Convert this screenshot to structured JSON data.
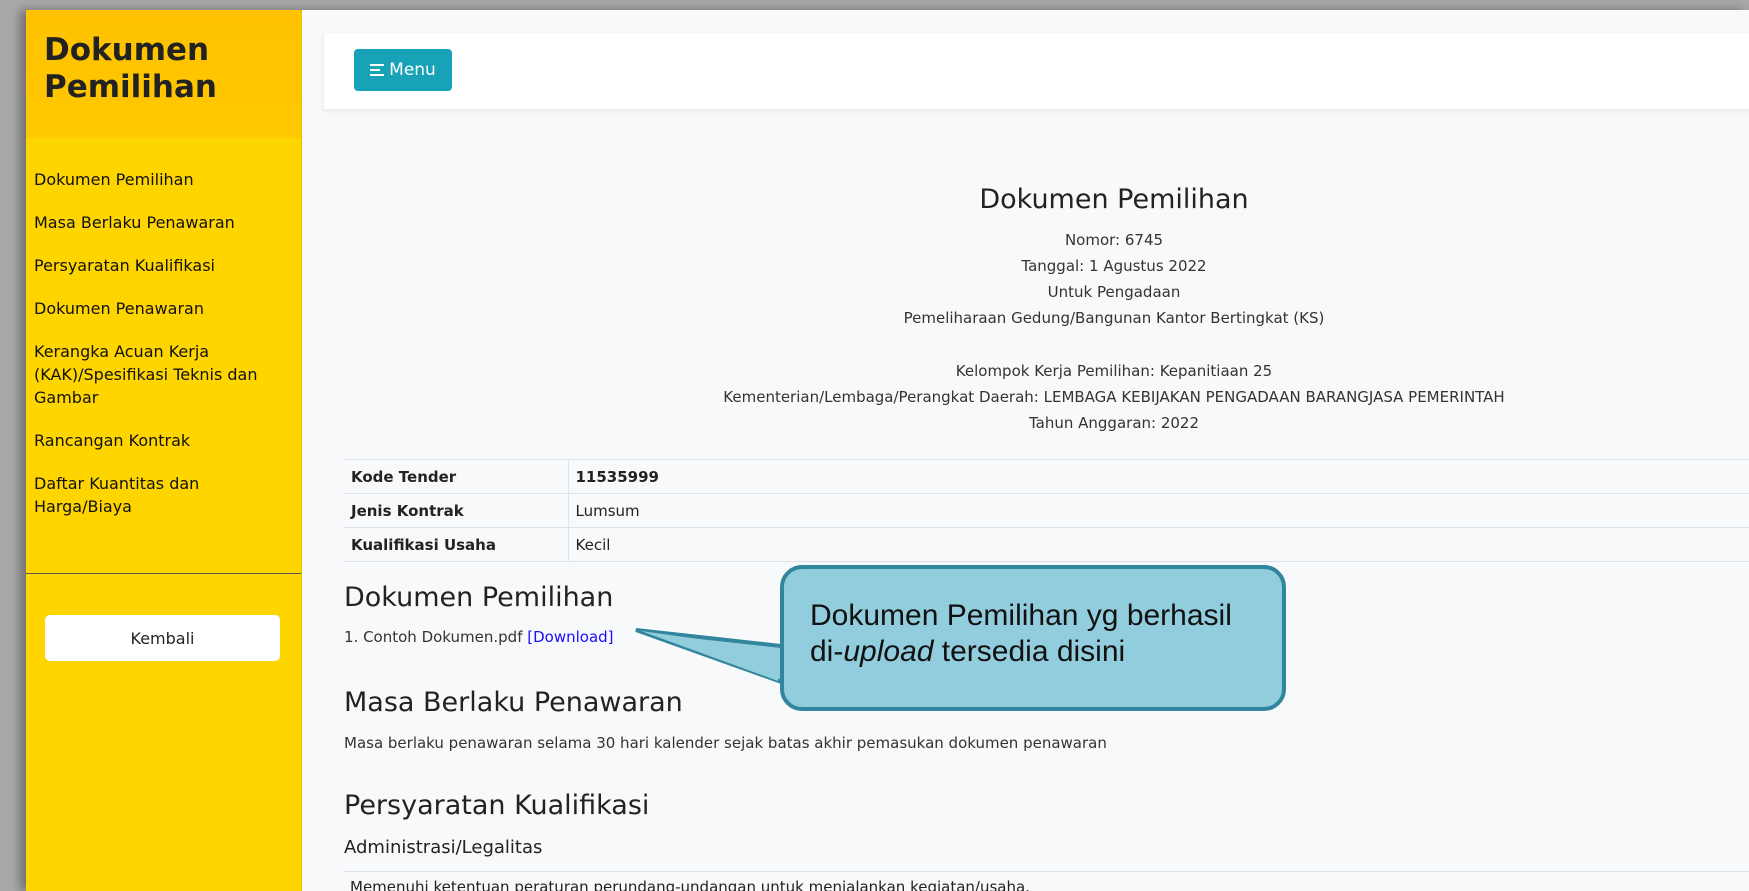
{
  "sidebar": {
    "title": "Dokumen Pemilihan",
    "items": [
      {
        "label": "Dokumen Pemilihan"
      },
      {
        "label": "Masa Berlaku Penawaran"
      },
      {
        "label": "Persyaratan Kualifikasi"
      },
      {
        "label": "Dokumen Penawaran"
      },
      {
        "label": "Kerangka Acuan Kerja (KAK)/Spesifikasi Teknis dan Gambar"
      },
      {
        "label": "Rancangan Kontrak"
      },
      {
        "label": "Daftar Kuantitas dan Harga/Biaya"
      }
    ],
    "back_label": "Kembali"
  },
  "topbar": {
    "menu_label": "Menu"
  },
  "document": {
    "title": "Dokumen Pemilihan",
    "nomor": "Nomor: 6745",
    "tanggal": "Tanggal: 1 Agustus 2022",
    "untuk": "Untuk Pengadaan",
    "pengadaan": "Pemeliharaan Gedung/Bangunan Kantor Bertingkat (KS)",
    "pokja": "Kelompok Kerja Pemilihan: Kepanitiaan 25",
    "instansi": "Kementerian/Lembaga/Perangkat Daerah: LEMBAGA KEBIJAKAN PENGADAAN BARANGJASA PEMERINTAH",
    "tahun": "Tahun Anggaran: 2022"
  },
  "info_table": [
    {
      "key": "Kode Tender",
      "value": "11535999"
    },
    {
      "key": "Jenis Kontrak",
      "value": "Lumsum"
    },
    {
      "key": "Kualifikasi Usaha",
      "value": "Kecil"
    }
  ],
  "sections": {
    "dokumen_pemilihan": {
      "title": "Dokumen Pemilihan",
      "file": "1. Contoh Dokumen.pdf",
      "download_label": "[Download]"
    },
    "masa_berlaku": {
      "title": "Masa Berlaku Penawaran",
      "text": "Masa berlaku penawaran selama 30 hari kalender sejak batas akhir pemasukan dokumen penawaran"
    },
    "persyaratan": {
      "title": "Persyaratan Kualifikasi",
      "subtitle": "Administrasi/Legalitas",
      "row": "Memenuhi ketentuan peraturan perundang-undangan untuk menjalankan kegiatan/usaha."
    }
  },
  "callout": {
    "line1": "Dokumen Pemilihan yg berhasil",
    "line2_prefix": "di-",
    "line2_italic": "upload",
    "line2_suffix": " tersedia disini",
    "fill": "#92cddd",
    "border": "#31859c"
  },
  "colors": {
    "sidebar": "#ffd500",
    "sidebar_header": "#ffc400",
    "menu_button": "#17a2b8",
    "link": "#1a0dff"
  },
  "icons": {
    "menu": "menu-lines-icon"
  }
}
